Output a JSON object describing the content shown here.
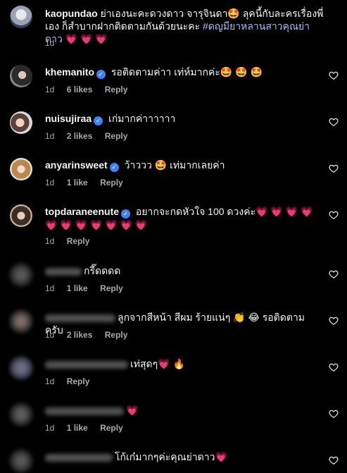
{
  "comments": [
    {
      "username": "kaopundao",
      "verified": false,
      "text": "ย่าเองนะคะดวงดาว จารุจินดา🤩 ลุคนี้กับละครเรื่องพี่เอง ก็สำบากฝากติดตามกันด้วยนะคะ",
      "hashtag": "#ดญมียาหลานสาวคุณย่าดาว",
      "text_after": "💗 💗 💗",
      "time": "1d",
      "likes": "",
      "reply": ""
    },
    {
      "username": "khemanito",
      "verified": true,
      "text": "รอติดตามค่าา เท่ห์มากค่ะ🤩 🤩 🤩",
      "time": "1d",
      "likes": "6 likes",
      "reply": "Reply"
    },
    {
      "username": "nuisujiraa",
      "verified": true,
      "text": "เก่มากค่าาาาาา",
      "time": "1d",
      "likes": "2 likes",
      "reply": "Reply"
    },
    {
      "username": "anyarinsweet",
      "verified": true,
      "text": "ว้าววว 🤩 เท่มากเลยค่า",
      "time": "1d",
      "likes": "1 like",
      "reply": "Reply"
    },
    {
      "username": "topdaraneenute",
      "verified": true,
      "text": "อยากจะกดหัวใจ 100 ดวงค่ะ💗 💗 💗 💗 💗 💗 💗 💗 💗 💗 💗",
      "time": "1d",
      "likes": "",
      "reply": "Reply"
    },
    {
      "username": "",
      "verified": false,
      "text": "กรี๊ดดดด",
      "time": "1d",
      "likes": "1 like",
      "reply": "Reply"
    },
    {
      "username": "",
      "verified": false,
      "text": "ลูกจากสีหน้า สีผม ร้ายแน่ๆ 👏 😂 รอติดตามครับ",
      "time": "1d",
      "likes": "2 likes",
      "reply": "Reply"
    },
    {
      "username": "",
      "verified": false,
      "text": "เท่สุดๆ💗 🔥",
      "time": "1d",
      "likes": "",
      "reply": "Reply"
    },
    {
      "username": "",
      "verified": false,
      "text": "💗",
      "time": "1d",
      "likes": "1 like",
      "reply": "Reply"
    },
    {
      "username": "",
      "verified": false,
      "text": "โก้เก๋มากๆค่ะคุณย่าดาว💗",
      "time": "",
      "likes": "",
      "reply": ""
    }
  ],
  "colors": {
    "background": "#000000",
    "text": "#f5f5f5",
    "muted": "#a8a8a8",
    "verified": "#3b82f6",
    "hashtag": "#a9bff8"
  },
  "icons": {
    "like": "heart-outline-icon",
    "verified": "verified-badge-icon"
  }
}
